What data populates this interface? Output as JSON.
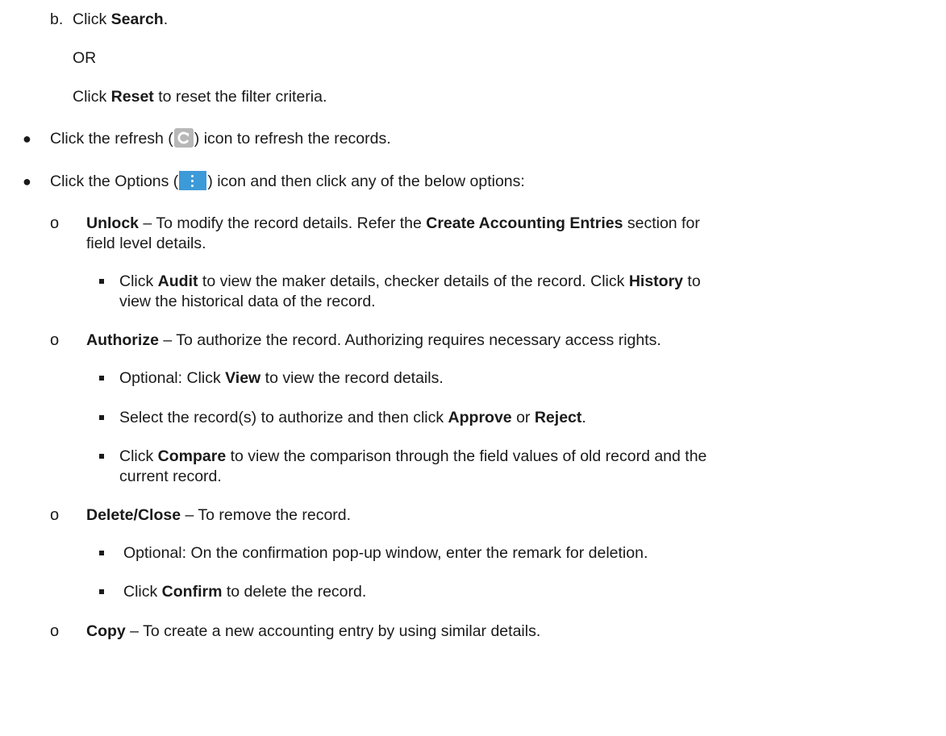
{
  "step_b": {
    "label": "b.",
    "click": "Click ",
    "search": "Search",
    "period": ".",
    "or": "OR",
    "reset_click": "Click ",
    "reset": "Reset",
    "reset_tail": " to reset the filter criteria."
  },
  "refresh": {
    "pre": "Click the refresh (",
    "icon": "refresh-icon",
    "post": ") icon to refresh the records."
  },
  "options": {
    "pre": "Click the Options (",
    "icon": "options-icon",
    "post": ") icon and then click any of the below options:"
  },
  "unlock": {
    "name": "Unlock",
    "mid": " – To modify the record details. Refer the ",
    "ref": "Create Accounting Entries",
    "tail": " section for",
    "line2": "field level details.",
    "audit": {
      "click": "Click ",
      "audit": "Audit",
      "mid": " to view the maker details, checker details of the record. Click ",
      "history": "History",
      "tail": " to",
      "line2": "view the historical data of the record."
    }
  },
  "authorize": {
    "name": "Authorize",
    "tail": " – To authorize the record. Authorizing requires necessary access rights.",
    "view": {
      "pre": "Optional: Click ",
      "bold": "View",
      "post": " to view the record details."
    },
    "select": {
      "pre": "Select the record(s) to authorize and then click ",
      "approve": "Approve",
      "or": " or ",
      "reject": "Reject",
      "end": "."
    },
    "compare": {
      "click": "Click ",
      "bold": "Compare",
      "tail": " to view the comparison through the field values of old record and the",
      "line2": "current record."
    }
  },
  "delete": {
    "name": "Delete/Close",
    "tail": " – To remove the record.",
    "optional": "Optional: On the confirmation pop-up window, enter the remark for deletion.",
    "confirm": {
      "click": "Click ",
      "bold": "Confirm",
      "tail": " to delete the record."
    }
  },
  "copy": {
    "name": "Copy",
    "tail": " – To create a new accounting entry by using similar details."
  },
  "colors": {
    "text": "#1a1a1a",
    "refresh_icon_bg": "#b7b7b7",
    "options_icon_bg": "#3d9ad8"
  }
}
